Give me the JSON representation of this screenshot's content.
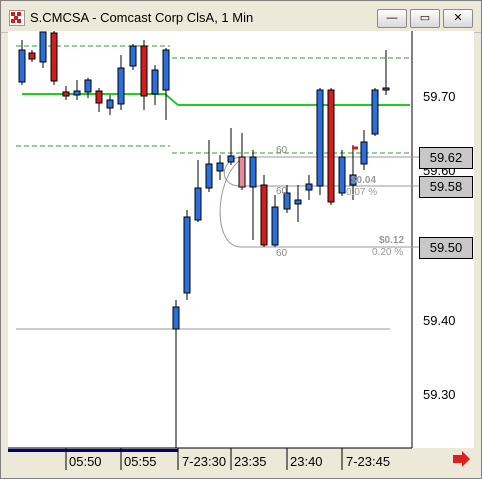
{
  "window": {
    "title": "S.CMCSA - Comcast Corp ClsA, 1 Min",
    "buttons": [
      "—",
      "▭",
      "✕"
    ]
  },
  "colors": {
    "up_candle": "#2a6fdb",
    "down_candle": "#d21d1d",
    "ma_line": "#22cc22",
    "level_line": "#2e9e2e",
    "axis_bar": "#000080"
  },
  "price_axis": {
    "ticks": [
      "59.70",
      "59.60",
      "59.40",
      "59.30"
    ],
    "markers": [
      "59.62",
      "59.58",
      "59.50"
    ]
  },
  "time_axis": {
    "labels": [
      "05:50",
      "05:55",
      "7-23:30",
      "23:35",
      "23:40",
      "7-23:45"
    ]
  },
  "annotations": {
    "level_counts": [
      "60",
      "60",
      "60"
    ],
    "trade_1": {
      "pnl": "$0.04",
      "pct": "0.07 %"
    },
    "trade_2": {
      "pnl": "$0.12",
      "pct": "0.20 %"
    }
  }
}
